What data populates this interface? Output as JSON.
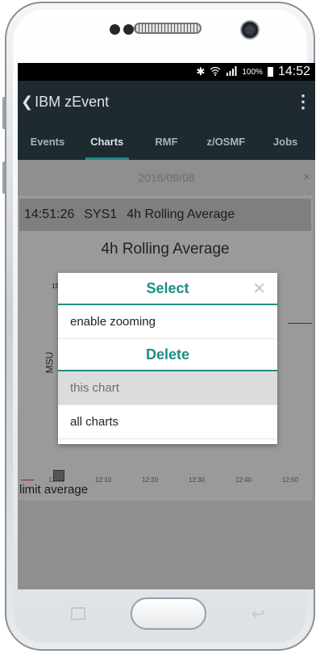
{
  "status_bar": {
    "icons": [
      "bluetooth-icon",
      "wifi-icon",
      "signal-icon"
    ],
    "battery": "100%",
    "time": "14:52"
  },
  "app_bar": {
    "back": "❮",
    "title": "IBM zEvent",
    "menu": "⋮"
  },
  "tabs": [
    {
      "label": "Events",
      "active": false
    },
    {
      "label": "Charts",
      "active": true
    },
    {
      "label": "RMF",
      "active": false
    },
    {
      "label": "z/OSMF",
      "active": false
    },
    {
      "label": "Jobs",
      "active": false
    }
  ],
  "chart_panel": {
    "date": "2016/09/08",
    "close": "×",
    "header": {
      "time": "14:51:26",
      "system": "SYS1",
      "name": "4h Rolling Average"
    },
    "title": "4h Rolling Average",
    "ylabel": "MSU",
    "y_top_tick": "15",
    "x_ticks": [
      "12:00",
      "12:10",
      "12:20",
      "12:30",
      "12:40",
      "12:50"
    ],
    "legend_label": "limit average"
  },
  "dialog": {
    "select_title": "Select",
    "close": "✕",
    "enable_zooming": "enable zooming",
    "delete_title": "Delete",
    "this_chart": "this chart",
    "all_charts": "all charts"
  },
  "colors": {
    "accent": "#1e8e88",
    "appbar": "#1f2a30"
  }
}
